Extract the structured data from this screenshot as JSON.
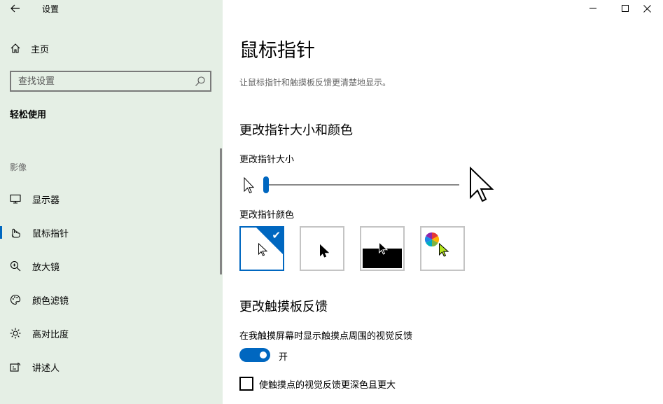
{
  "app": {
    "title": "设置"
  },
  "sidebar": {
    "home_label": "主页",
    "search_placeholder": "查找设置",
    "section_title": "轻松使用",
    "category": "影像",
    "items": [
      {
        "label": "显示器",
        "icon": "monitor-icon"
      },
      {
        "label": "鼠标指针",
        "icon": "mouse-pointer-icon",
        "active": true
      },
      {
        "label": "放大镜",
        "icon": "magnifier-icon"
      },
      {
        "label": "颜色滤镜",
        "icon": "palette-icon"
      },
      {
        "label": "高对比度",
        "icon": "brightness-icon"
      },
      {
        "label": "讲述人",
        "icon": "narrator-icon"
      }
    ]
  },
  "main": {
    "title": "鼠标指针",
    "description": "让鼠标指针和触摸板反馈更清楚地显示。",
    "size_color_heading": "更改指针大小和颜色",
    "size_label": "更改指针大小",
    "size_value": 1,
    "color_label": "更改指针颜色",
    "color_options": [
      {
        "name": "white",
        "selected": true
      },
      {
        "name": "black",
        "selected": false
      },
      {
        "name": "inverted",
        "selected": false
      },
      {
        "name": "custom",
        "selected": false
      }
    ],
    "touch_heading": "更改触摸板反馈",
    "touch_label": "在我触摸屏幕时显示触摸点周围的视觉反馈",
    "toggle_state": "开",
    "checkbox_label": "使触摸点的视觉反馈更深色且更大",
    "checkbox_checked": false
  },
  "colors": {
    "accent": "#0067c0",
    "sidebar_bg": "#e5efe5"
  }
}
